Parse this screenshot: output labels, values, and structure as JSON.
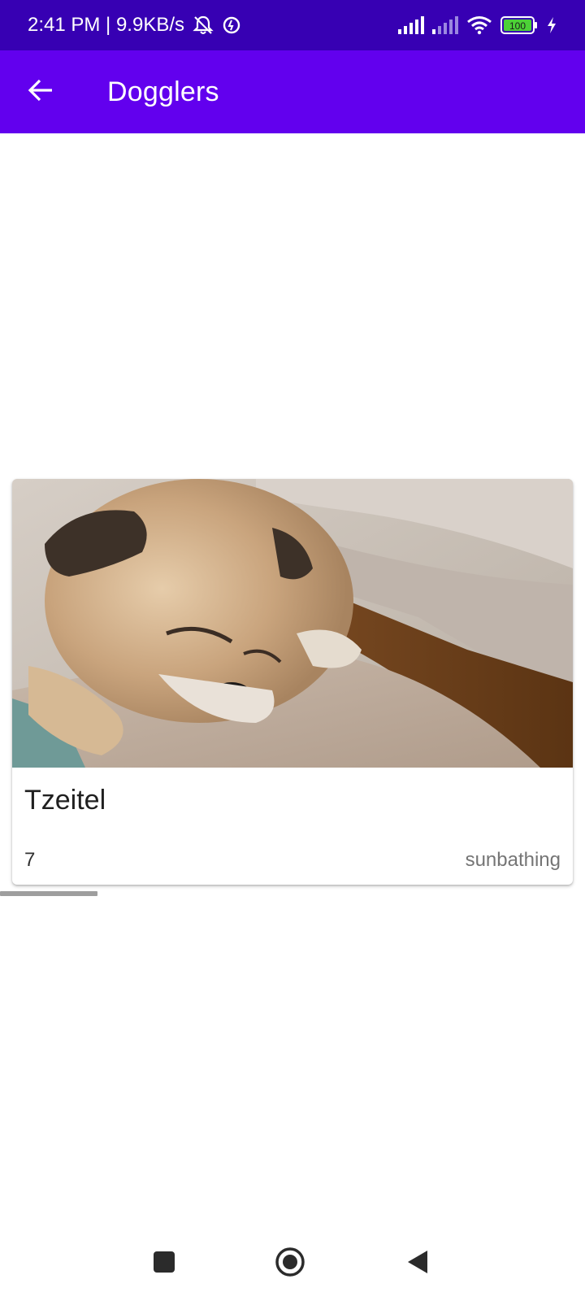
{
  "status_bar": {
    "time_speed": "2:41 PM | 9.9KB/s",
    "battery_level": "100",
    "icons": [
      "mute-notifications-icon",
      "data-saver-icon",
      "signal-strength-icon",
      "signal-strength-secondary-icon",
      "wifi-icon",
      "battery-icon",
      "charging-icon"
    ]
  },
  "app_bar": {
    "title": "Dogglers",
    "back_icon": "arrow-back-icon"
  },
  "card": {
    "name": "Tzeitel",
    "age": "7",
    "hobby": "sunbathing"
  },
  "nav_bar": {
    "icons": [
      "recent-apps-icon",
      "home-icon",
      "back-triangle-icon"
    ]
  },
  "colors": {
    "status_bar": "#3700B3",
    "app_bar": "#6200EE",
    "background": "#FFFFFF",
    "battery_fill": "#4CD137"
  }
}
